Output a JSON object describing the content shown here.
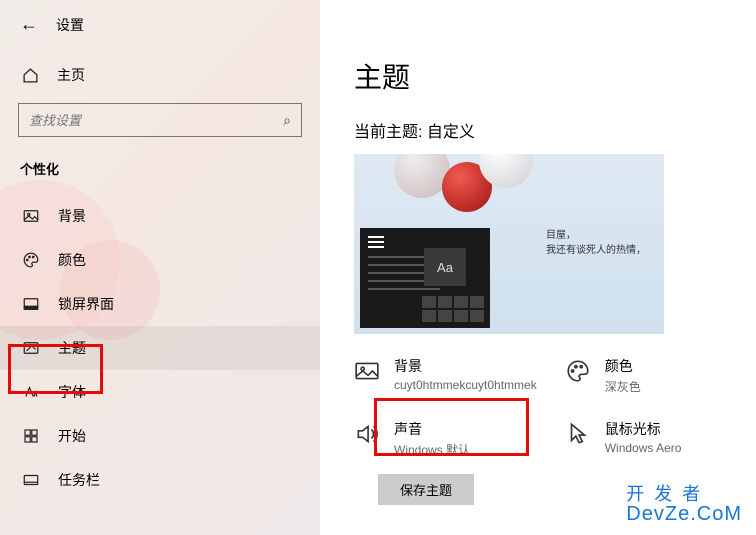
{
  "header": {
    "app_title": "设置"
  },
  "home": {
    "label": "主页"
  },
  "search": {
    "placeholder": "查找设置"
  },
  "category": {
    "label": "个性化"
  },
  "sidebar": {
    "items": [
      {
        "label": "背景"
      },
      {
        "label": "颜色"
      },
      {
        "label": "锁屏界面"
      },
      {
        "label": "主题"
      },
      {
        "label": "字体"
      },
      {
        "label": "开始"
      },
      {
        "label": "任务栏"
      }
    ]
  },
  "main": {
    "title": "主题",
    "current_theme_label": "当前主题: 自定义",
    "preview_sample": "Aa",
    "preview_text_1": "目屋，",
    "preview_text_2": "我还有谈死人的热情，",
    "settings": {
      "background": {
        "label": "背景",
        "value": "cuyt0htmmekcuyt0htmmek"
      },
      "color": {
        "label": "颜色",
        "value": "深灰色"
      },
      "sound": {
        "label": "声音",
        "value": "Windows 默认"
      },
      "cursor": {
        "label": "鼠标光标",
        "value": "Windows Aero"
      }
    },
    "save_button": "保存主题"
  },
  "watermark": {
    "line1": "开发者",
    "line2": "DevZe.CoM"
  }
}
